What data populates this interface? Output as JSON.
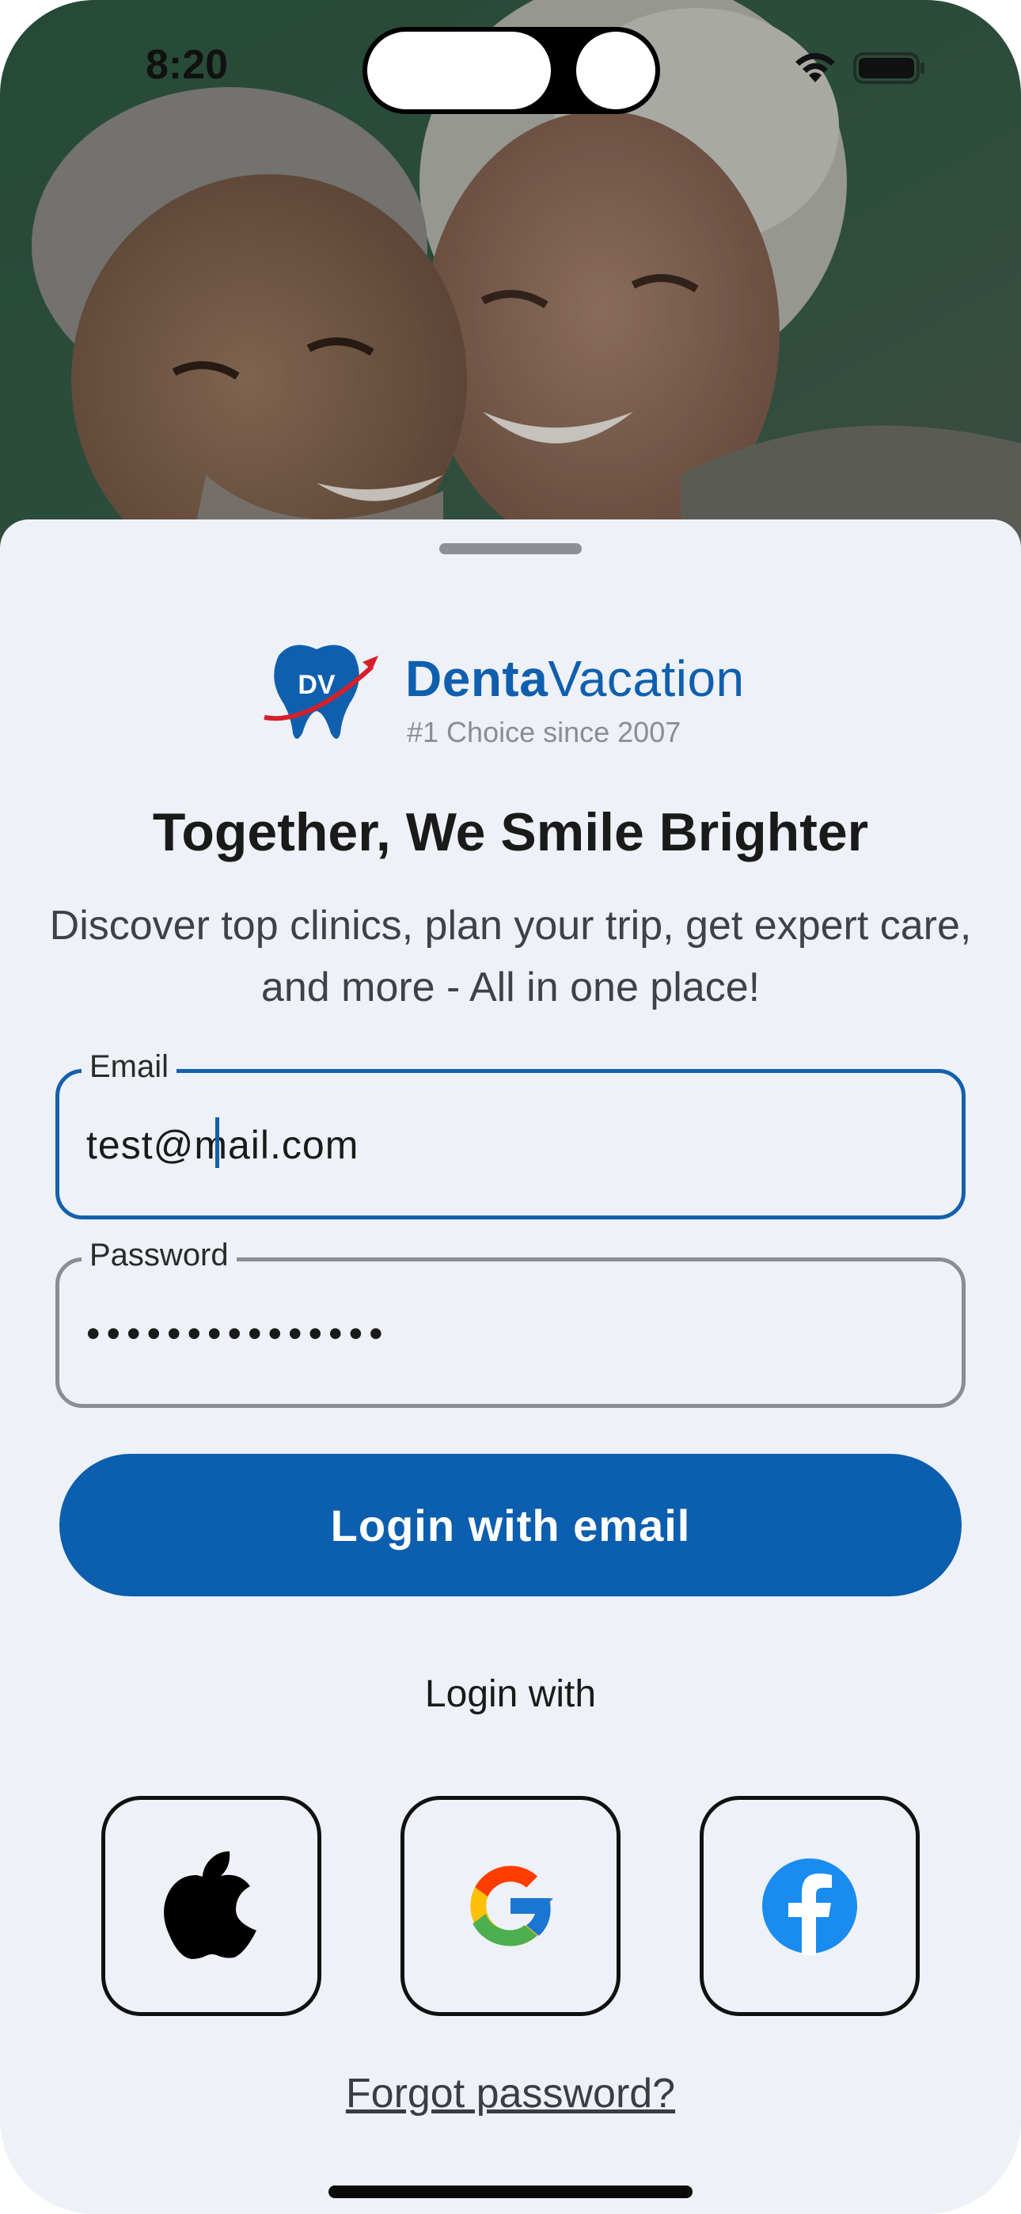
{
  "status": {
    "time": "8:20"
  },
  "brand": {
    "name_bold": "Denta",
    "name_regular": "Vacation",
    "tagline": "#1 Choice since 2007",
    "logo_text": "DV",
    "color": "#0f5fae"
  },
  "headline": "Together, We Smile Brighter",
  "subtext": "Discover top clinics, plan your trip, get expert care, and more - All in one place!",
  "email": {
    "label": "Email",
    "value": "test@mail.com"
  },
  "password": {
    "label": "Password",
    "masked": "•••••••••••••••"
  },
  "login_button": "Login with email",
  "login_with_label": "Login with",
  "social": [
    {
      "name": "apple",
      "icon": "apple-icon"
    },
    {
      "name": "google",
      "icon": "google-icon"
    },
    {
      "name": "facebook",
      "icon": "facebook-icon"
    }
  ],
  "forgot_password": "Forgot password?",
  "colors": {
    "primary": "#0c5eae",
    "background": "#eef1f7",
    "focus": "#1460ad"
  }
}
